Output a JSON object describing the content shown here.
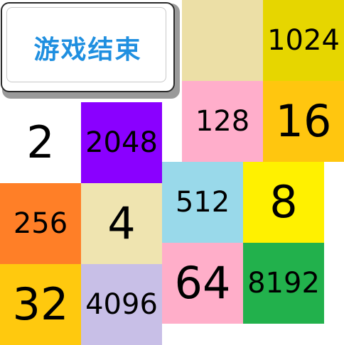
{
  "status": {
    "title": "游戏结束"
  },
  "tiles": [
    {
      "value": "1024",
      "color": "#e6d600"
    },
    {
      "value": "128",
      "color": "#ffaecb"
    },
    {
      "value": "16",
      "color": "#ffc60f"
    },
    {
      "value": "2",
      "color": "#ffffff"
    },
    {
      "value": "2048",
      "color": "#8a00ff"
    },
    {
      "value": "512",
      "color": "#99d9ea"
    },
    {
      "value": "8",
      "color": "#fff100"
    },
    {
      "value": "256",
      "color": "#ff7f27"
    },
    {
      "value": "4",
      "color": "#efe4b0"
    },
    {
      "value": "64",
      "color": "#ffaec9"
    },
    {
      "value": "8192",
      "color": "#22b14c"
    },
    {
      "value": "32",
      "color": "#ffc90e"
    },
    {
      "value": "4096",
      "color": "#c8bfe7"
    },
    {
      "value": "",
      "color": "#efe0a8"
    }
  ]
}
